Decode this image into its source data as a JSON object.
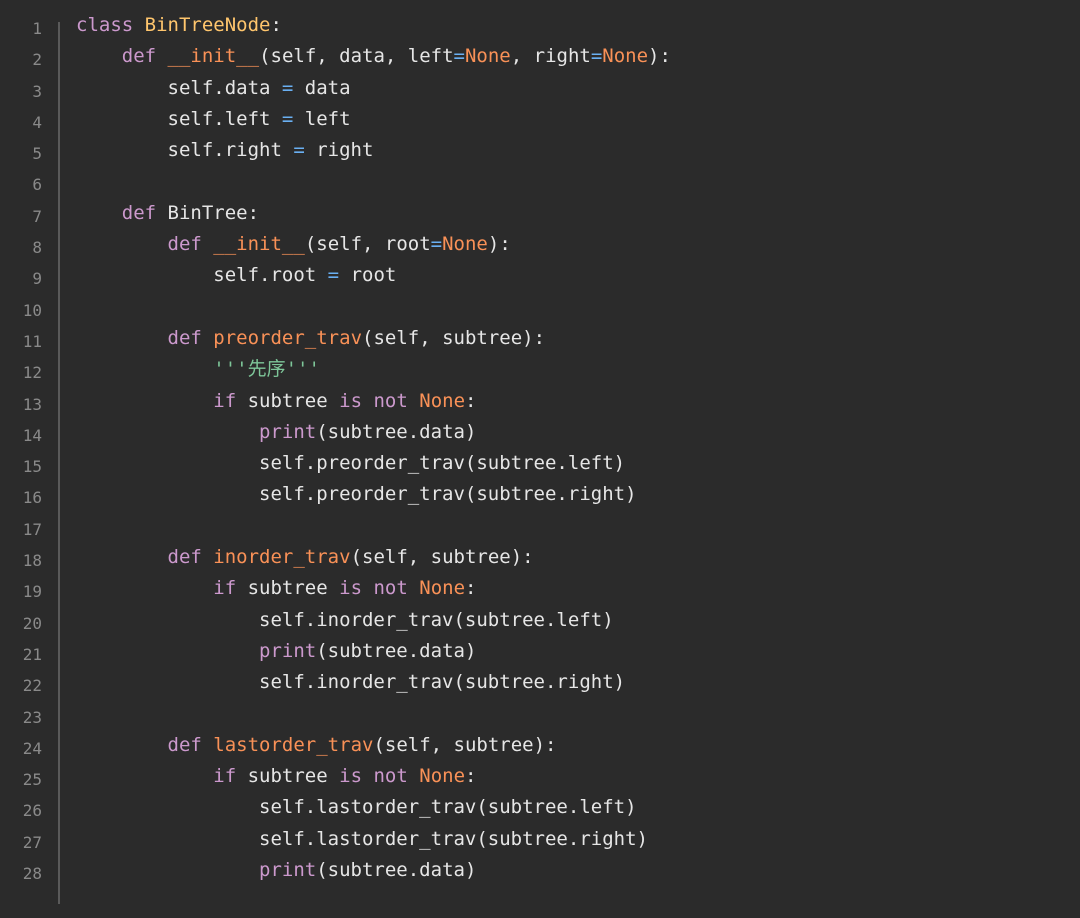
{
  "colors": {
    "background": "#2b2b2b",
    "line_number": "#8a8a8a",
    "keyword": "#cc99cd",
    "class_name": "#ffc66d",
    "function_name": "#f99157",
    "operator": "#6ab0f3",
    "constant": "#f99157",
    "string": "#7ec699",
    "text": "#e6e6e6"
  },
  "lines": [
    {
      "n": "1",
      "tokens": [
        [
          "kw",
          "class"
        ],
        [
          "plain",
          " "
        ],
        [
          "cls",
          "BinTreeNode"
        ],
        [
          "plain",
          ":"
        ]
      ]
    },
    {
      "n": "2",
      "tokens": [
        [
          "plain",
          "    "
        ],
        [
          "kw",
          "def"
        ],
        [
          "plain",
          " "
        ],
        [
          "fn",
          "__init__"
        ],
        [
          "plain",
          "(self, data, left"
        ],
        [
          "op",
          "="
        ],
        [
          "const",
          "None"
        ],
        [
          "plain",
          ", right"
        ],
        [
          "op",
          "="
        ],
        [
          "const",
          "None"
        ],
        [
          "plain",
          "):"
        ]
      ]
    },
    {
      "n": "3",
      "tokens": [
        [
          "plain",
          "        self.data "
        ],
        [
          "op",
          "="
        ],
        [
          "plain",
          " data"
        ]
      ]
    },
    {
      "n": "4",
      "tokens": [
        [
          "plain",
          "        self.left "
        ],
        [
          "op",
          "="
        ],
        [
          "plain",
          " left"
        ]
      ]
    },
    {
      "n": "5",
      "tokens": [
        [
          "plain",
          "        self.right "
        ],
        [
          "op",
          "="
        ],
        [
          "plain",
          " right"
        ]
      ]
    },
    {
      "n": "6",
      "tokens": []
    },
    {
      "n": "7",
      "tokens": [
        [
          "plain",
          "    "
        ],
        [
          "kw",
          "def"
        ],
        [
          "plain",
          " BinTree:"
        ]
      ]
    },
    {
      "n": "8",
      "tokens": [
        [
          "plain",
          "        "
        ],
        [
          "kw",
          "def"
        ],
        [
          "plain",
          " "
        ],
        [
          "fn",
          "__init__"
        ],
        [
          "plain",
          "(self, root"
        ],
        [
          "op",
          "="
        ],
        [
          "const",
          "None"
        ],
        [
          "plain",
          "):"
        ]
      ]
    },
    {
      "n": "9",
      "tokens": [
        [
          "plain",
          "            self.root "
        ],
        [
          "op",
          "="
        ],
        [
          "plain",
          " root"
        ]
      ]
    },
    {
      "n": "10",
      "tokens": []
    },
    {
      "n": "11",
      "tokens": [
        [
          "plain",
          "        "
        ],
        [
          "kw",
          "def"
        ],
        [
          "plain",
          " "
        ],
        [
          "fn",
          "preorder_trav"
        ],
        [
          "plain",
          "(self, subtree):"
        ]
      ]
    },
    {
      "n": "12",
      "tokens": [
        [
          "plain",
          "            "
        ],
        [
          "str",
          "'''先序'''"
        ]
      ]
    },
    {
      "n": "13",
      "tokens": [
        [
          "plain",
          "            "
        ],
        [
          "kw",
          "if"
        ],
        [
          "plain",
          " subtree "
        ],
        [
          "kw",
          "is"
        ],
        [
          "plain",
          " "
        ],
        [
          "kw",
          "not"
        ],
        [
          "plain",
          " "
        ],
        [
          "const",
          "None"
        ],
        [
          "plain",
          ":"
        ]
      ]
    },
    {
      "n": "14",
      "tokens": [
        [
          "plain",
          "                "
        ],
        [
          "kw",
          "print"
        ],
        [
          "plain",
          "(subtree.data)"
        ]
      ]
    },
    {
      "n": "15",
      "tokens": [
        [
          "plain",
          "                self.preorder_trav(subtree.left)"
        ]
      ]
    },
    {
      "n": "16",
      "tokens": [
        [
          "plain",
          "                self.preorder_trav(subtree.right)"
        ]
      ]
    },
    {
      "n": "17",
      "tokens": []
    },
    {
      "n": "18",
      "tokens": [
        [
          "plain",
          "        "
        ],
        [
          "kw",
          "def"
        ],
        [
          "plain",
          " "
        ],
        [
          "fn",
          "inorder_trav"
        ],
        [
          "plain",
          "(self, subtree):"
        ]
      ]
    },
    {
      "n": "19",
      "tokens": [
        [
          "plain",
          "            "
        ],
        [
          "kw",
          "if"
        ],
        [
          "plain",
          " subtree "
        ],
        [
          "kw",
          "is"
        ],
        [
          "plain",
          " "
        ],
        [
          "kw",
          "not"
        ],
        [
          "plain",
          " "
        ],
        [
          "const",
          "None"
        ],
        [
          "plain",
          ":"
        ]
      ]
    },
    {
      "n": "20",
      "tokens": [
        [
          "plain",
          "                self.inorder_trav(subtree.left)"
        ]
      ]
    },
    {
      "n": "21",
      "tokens": [
        [
          "plain",
          "                "
        ],
        [
          "kw",
          "print"
        ],
        [
          "plain",
          "(subtree.data)"
        ]
      ]
    },
    {
      "n": "22",
      "tokens": [
        [
          "plain",
          "                self.inorder_trav(subtree.right)"
        ]
      ]
    },
    {
      "n": "23",
      "tokens": []
    },
    {
      "n": "24",
      "tokens": [
        [
          "plain",
          "        "
        ],
        [
          "kw",
          "def"
        ],
        [
          "plain",
          " "
        ],
        [
          "fn",
          "lastorder_trav"
        ],
        [
          "plain",
          "(self, subtree):"
        ]
      ]
    },
    {
      "n": "25",
      "tokens": [
        [
          "plain",
          "            "
        ],
        [
          "kw",
          "if"
        ],
        [
          "plain",
          " subtree "
        ],
        [
          "kw",
          "is"
        ],
        [
          "plain",
          " "
        ],
        [
          "kw",
          "not"
        ],
        [
          "plain",
          " "
        ],
        [
          "const",
          "None"
        ],
        [
          "plain",
          ":"
        ]
      ]
    },
    {
      "n": "26",
      "tokens": [
        [
          "plain",
          "                self.lastorder_trav(subtree.left)"
        ]
      ]
    },
    {
      "n": "27",
      "tokens": [
        [
          "plain",
          "                self.lastorder_trav(subtree.right)"
        ]
      ]
    },
    {
      "n": "28",
      "tokens": [
        [
          "plain",
          "                "
        ],
        [
          "kw",
          "print"
        ],
        [
          "plain",
          "(subtree.data)"
        ]
      ]
    }
  ]
}
